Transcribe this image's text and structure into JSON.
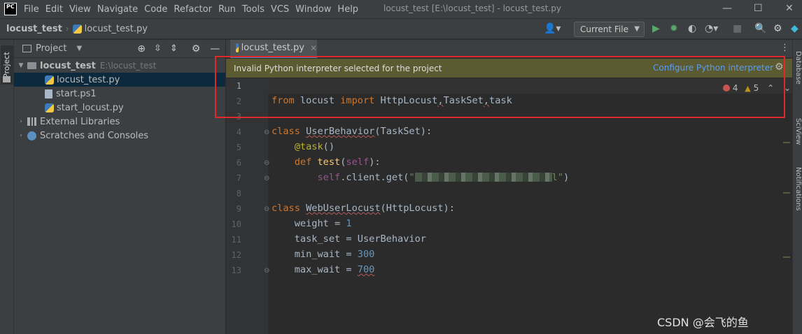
{
  "menubar": {
    "logo": "PC",
    "items": [
      "File",
      "Edit",
      "View",
      "Navigate",
      "Code",
      "Refactor",
      "Run",
      "Tools",
      "VCS",
      "Window",
      "Help"
    ],
    "window_title": "locust_test [E:\\locust_test] - locust_test.py"
  },
  "navbar": {
    "project": "locust_test",
    "file": "locust_test.py",
    "run_config": "Current File"
  },
  "project_panel": {
    "title": "Project",
    "root": {
      "label": "locust_test",
      "path": "E:\\locust_test"
    },
    "files": [
      "locust_test.py",
      "start.ps1",
      "start_locust.py"
    ],
    "external_libraries": "External Libraries",
    "scratches": "Scratches and Consoles"
  },
  "left_strip": {
    "label": "Project"
  },
  "editor": {
    "tab_label": "locust_test.py",
    "banner_message": "Invalid Python interpreter selected for the project",
    "banner_action": "Configure Python interpreter",
    "errors": "4",
    "warnings": "5",
    "line_numbers": [
      "1",
      "2",
      "3",
      "4",
      "5",
      "6",
      "7",
      "8",
      "9",
      "10",
      "11",
      "12",
      "13"
    ]
  },
  "right_strip": {
    "labels": [
      "Database",
      "SciView",
      "Notifications"
    ]
  },
  "watermark": "CSDN @会飞的鱼"
}
